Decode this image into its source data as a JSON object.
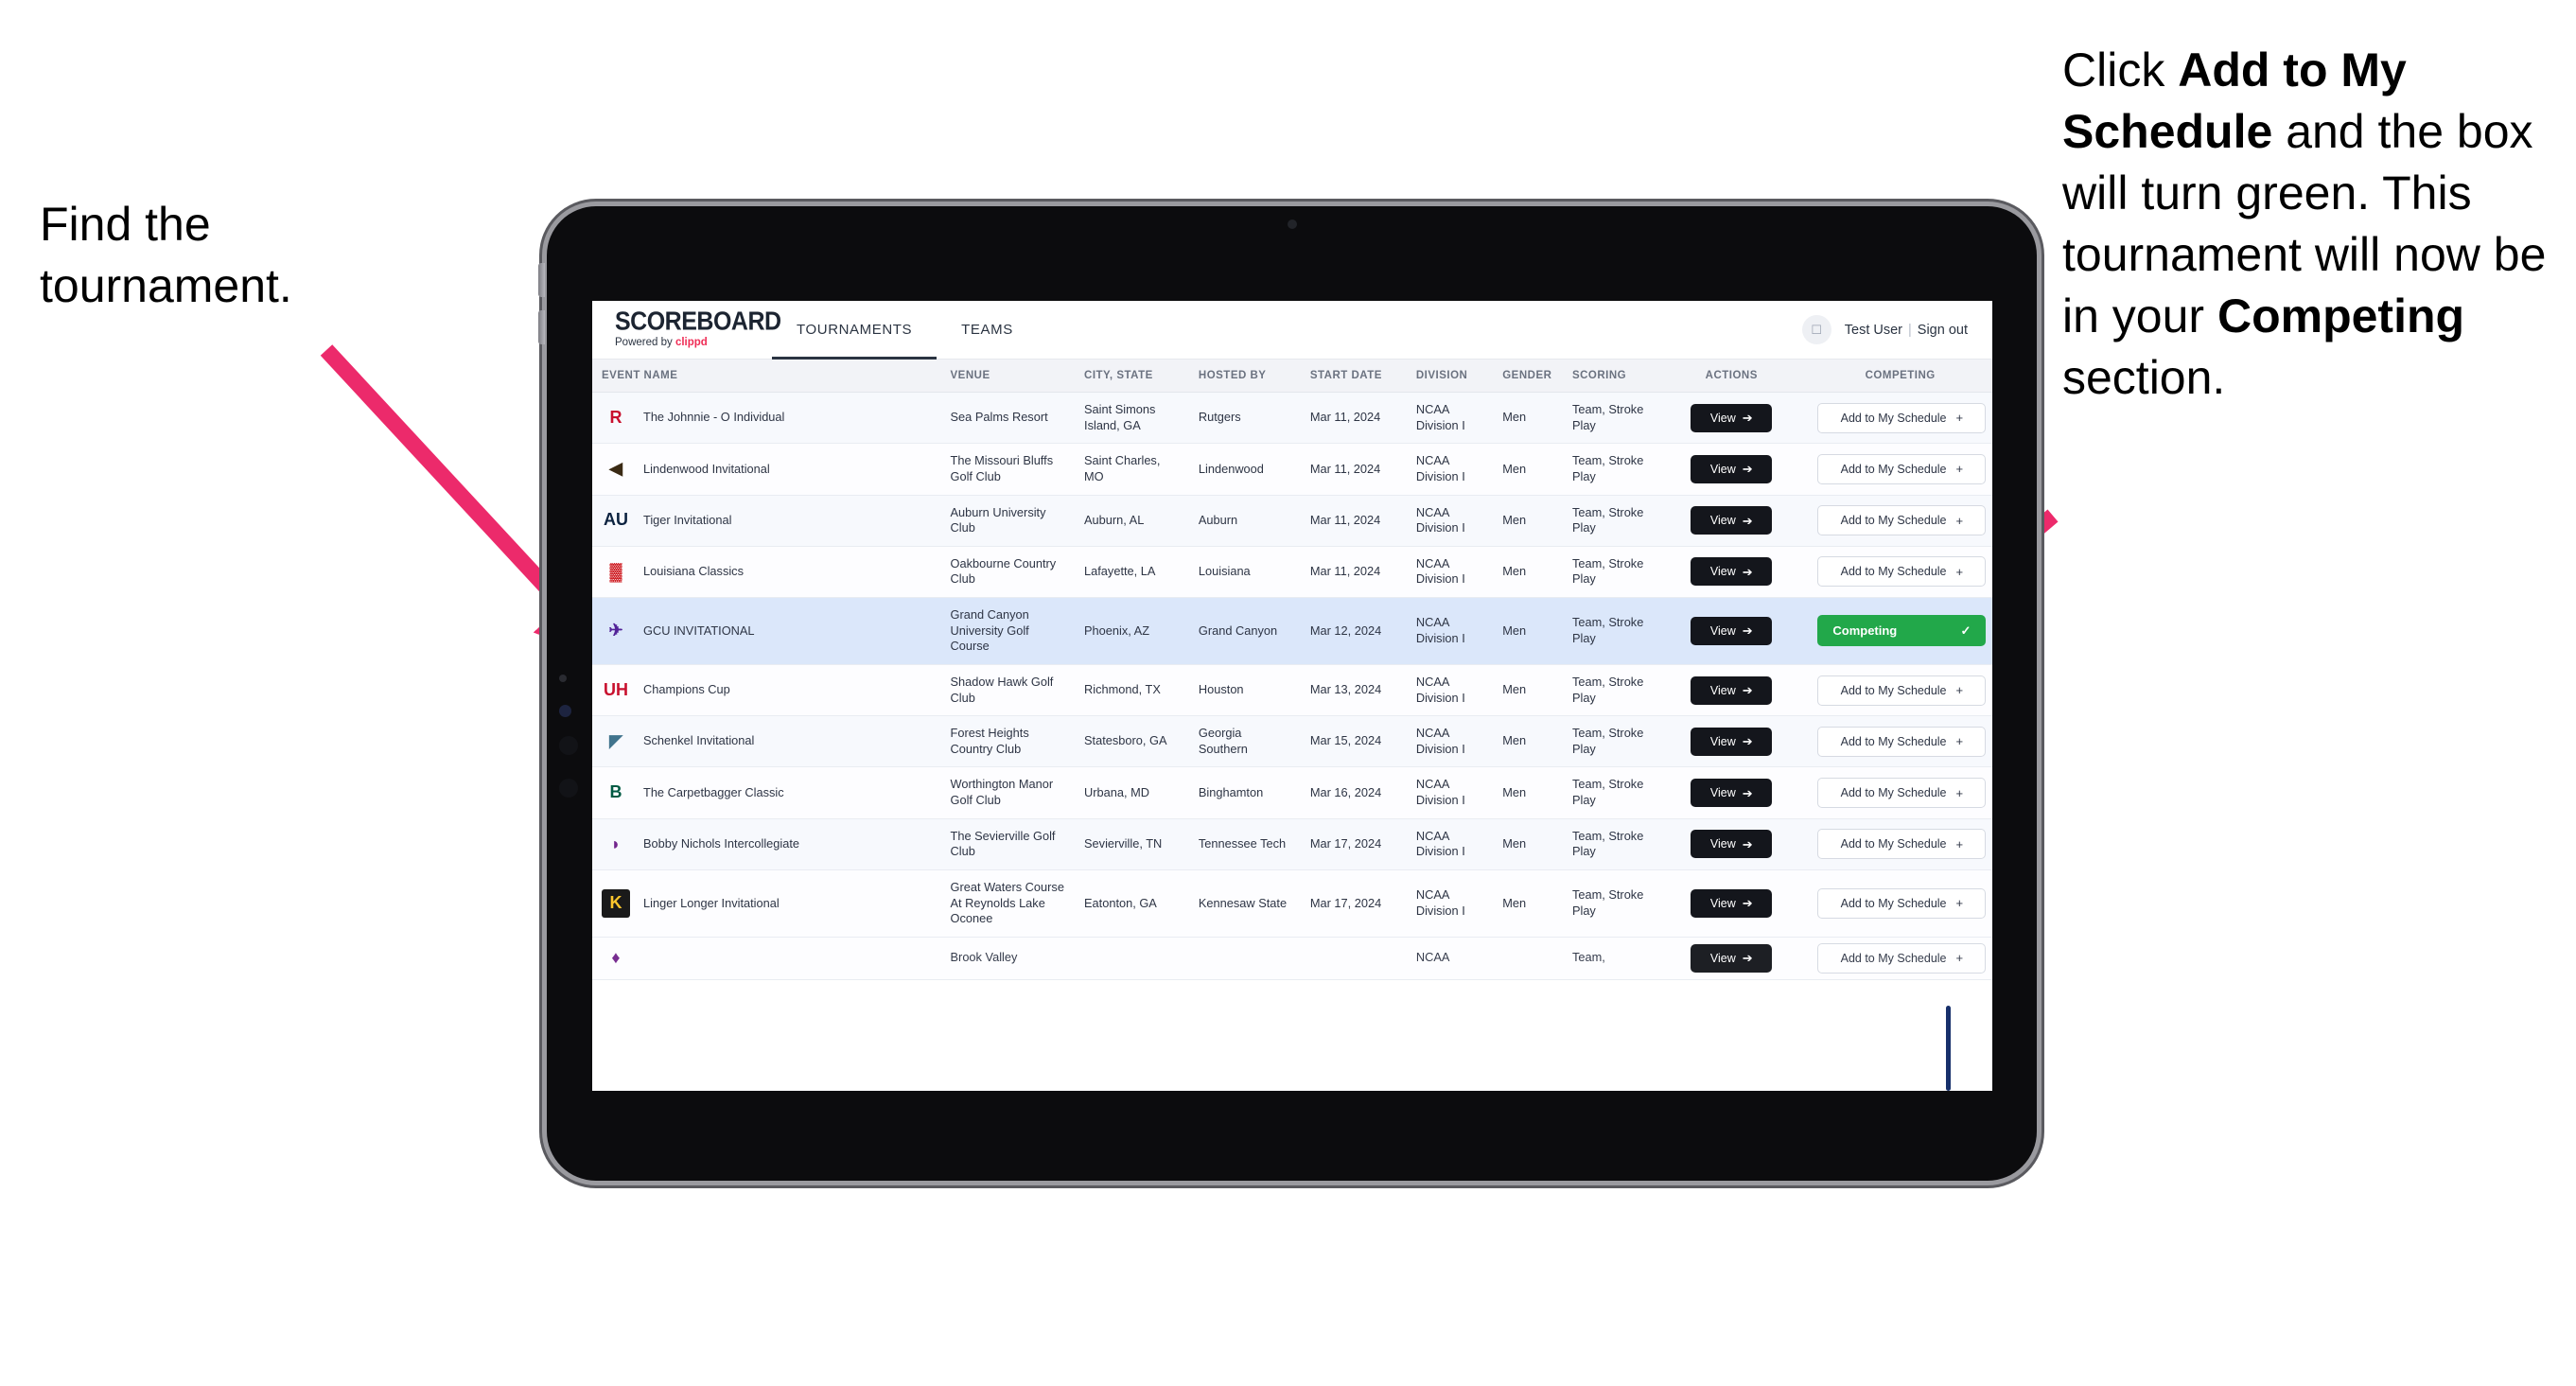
{
  "annotations": {
    "left": "Find the tournament.",
    "right_parts": [
      "Click ",
      "Add to My Schedule",
      " and the box will turn green. This tournament will now be in your ",
      "Competing",
      " section."
    ],
    "arrow_color": "#ec2a6b"
  },
  "app": {
    "brand": {
      "title": "SCOREBOARD",
      "powered_prefix": "Powered by ",
      "powered_name": "clippd"
    },
    "tabs": [
      {
        "label": "TOURNAMENTS",
        "active": true
      },
      {
        "label": "TEAMS",
        "active": false
      }
    ],
    "user": {
      "avatar_icon": "user-avatar-icon",
      "name": "Test User",
      "separator": "|",
      "sign_out": "Sign out"
    },
    "table": {
      "columns": [
        "EVENT NAME",
        "VENUE",
        "CITY, STATE",
        "HOSTED BY",
        "START DATE",
        "DIVISION",
        "GENDER",
        "SCORING",
        "ACTIONS",
        "COMPETING"
      ],
      "view_label": "View",
      "view_icon": "circle-arrow-right-icon",
      "add_label": "Add to My Schedule",
      "add_icon": "plus-icon",
      "competing_label": "Competing",
      "competing_icon": "check-icon",
      "competing_color": "#22a84a",
      "rows": [
        {
          "event": "The Johnnie - O Individual",
          "logo": "R",
          "logo_color": "#c8102e",
          "logo_bg": "transparent",
          "venue": "Sea Palms Resort",
          "city": "Saint Simons Island, GA",
          "host": "Rutgers",
          "date": "Mar 11, 2024",
          "division": "NCAA Division I",
          "gender": "Men",
          "scoring": "Team, Stroke Play",
          "competing": false
        },
        {
          "event": "Lindenwood Invitational",
          "logo": "◀",
          "logo_color": "#3a2a14",
          "logo_bg": "transparent",
          "venue": "The Missouri Bluffs Golf Club",
          "city": "Saint Charles, MO",
          "host": "Lindenwood",
          "date": "Mar 11, 2024",
          "division": "NCAA Division I",
          "gender": "Men",
          "scoring": "Team, Stroke Play",
          "competing": false
        },
        {
          "event": "Tiger Invitational",
          "logo": "AU",
          "logo_color": "#0c2340",
          "logo_bg": "transparent",
          "venue": "Auburn University Club",
          "city": "Auburn, AL",
          "host": "Auburn",
          "date": "Mar 11, 2024",
          "division": "NCAA Division I",
          "gender": "Men",
          "scoring": "Team, Stroke Play",
          "competing": false
        },
        {
          "event": "Louisiana Classics",
          "logo": "▓",
          "logo_color": "#ce181e",
          "logo_bg": "transparent",
          "venue": "Oakbourne Country Club",
          "city": "Lafayette, LA",
          "host": "Louisiana",
          "date": "Mar 11, 2024",
          "division": "NCAA Division I",
          "gender": "Men",
          "scoring": "Team, Stroke Play",
          "competing": false
        },
        {
          "event": "GCU INVITATIONAL",
          "logo": "✈",
          "logo_color": "#522398",
          "logo_bg": "transparent",
          "venue": "Grand Canyon University Golf Course",
          "city": "Phoenix, AZ",
          "host": "Grand Canyon",
          "date": "Mar 12, 2024",
          "division": "NCAA Division I",
          "gender": "Men",
          "scoring": "Team, Stroke Play",
          "competing": true
        },
        {
          "event": "Champions Cup",
          "logo": "UH",
          "logo_color": "#c8102e",
          "logo_bg": "transparent",
          "venue": "Shadow Hawk Golf Club",
          "city": "Richmond, TX",
          "host": "Houston",
          "date": "Mar 13, 2024",
          "division": "NCAA Division I",
          "gender": "Men",
          "scoring": "Team, Stroke Play",
          "competing": false
        },
        {
          "event": "Schenkel Invitational",
          "logo": "◤",
          "logo_color": "#41748d",
          "logo_bg": "transparent",
          "venue": "Forest Heights Country Club",
          "city": "Statesboro, GA",
          "host": "Georgia Southern",
          "date": "Mar 15, 2024",
          "division": "NCAA Division I",
          "gender": "Men",
          "scoring": "Team, Stroke Play",
          "competing": false
        },
        {
          "event": "The Carpetbagger Classic",
          "logo": "B",
          "logo_color": "#005a43",
          "logo_bg": "transparent",
          "venue": "Worthington Manor Golf Club",
          "city": "Urbana, MD",
          "host": "Binghamton",
          "date": "Mar 16, 2024",
          "division": "NCAA Division I",
          "gender": "Men",
          "scoring": "Team, Stroke Play",
          "competing": false
        },
        {
          "event": "Bobby Nichols Intercollegiate",
          "logo": "◗",
          "logo_color": "#73268d",
          "logo_bg": "transparent",
          "venue": "The Sevierville Golf Club",
          "city": "Sevierville, TN",
          "host": "Tennessee Tech",
          "date": "Mar 17, 2024",
          "division": "NCAA Division I",
          "gender": "Men",
          "scoring": "Team, Stroke Play",
          "competing": false
        },
        {
          "event": "Linger Longer Invitational",
          "logo": "K",
          "logo_color": "#ffc72c",
          "logo_bg": "#1a1a1a",
          "venue": "Great Waters Course At Reynolds Lake Oconee",
          "city": "Eatonton, GA",
          "host": "Kennesaw State",
          "date": "Mar 17, 2024",
          "division": "NCAA Division I",
          "gender": "Men",
          "scoring": "Team, Stroke Play",
          "competing": false
        }
      ],
      "clipped_row": {
        "venue": "Brook Valley",
        "division": "NCAA",
        "scoring": "Team,"
      }
    }
  }
}
